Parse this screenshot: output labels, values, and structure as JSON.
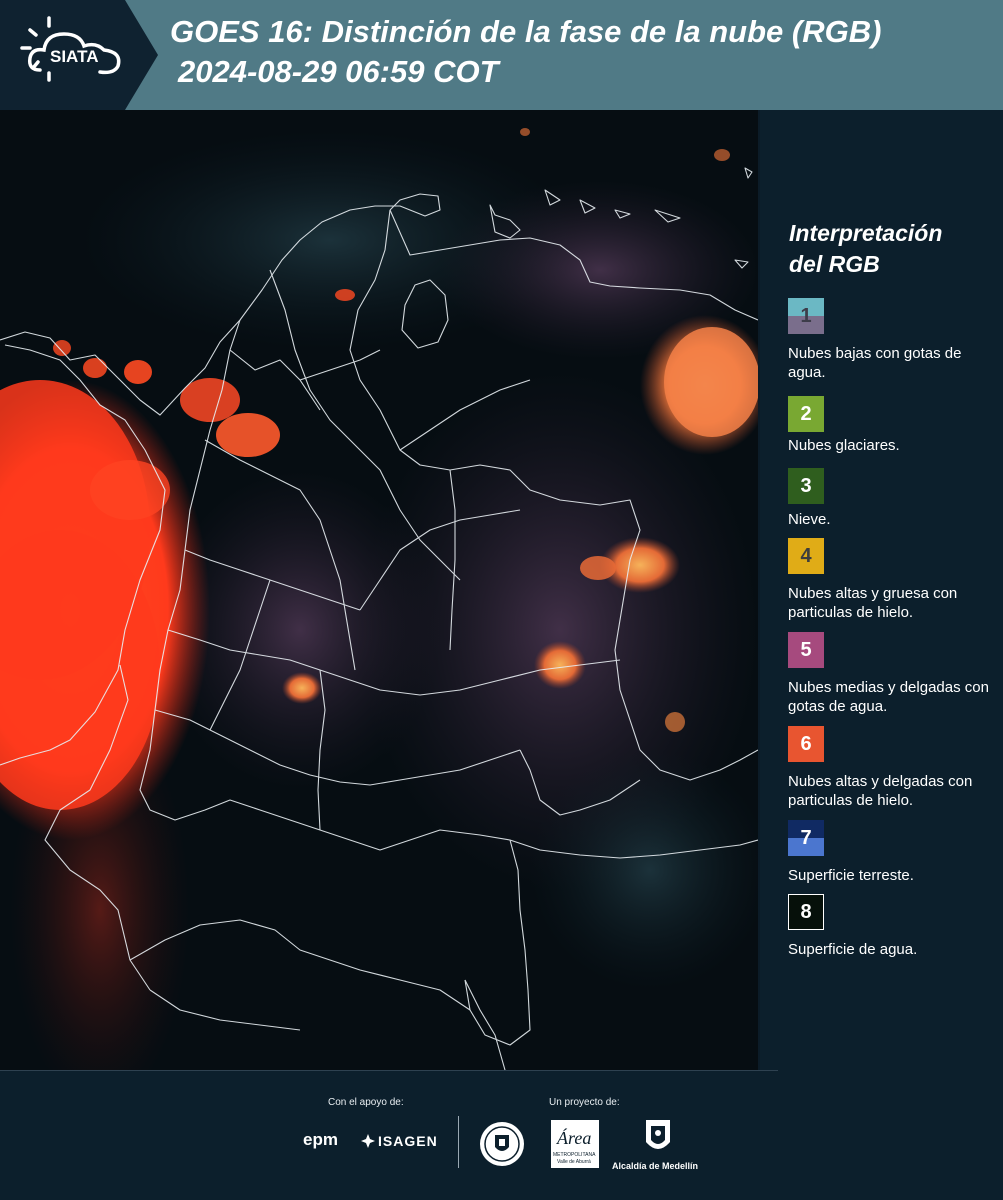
{
  "header": {
    "logo_text": "SIATA",
    "title_line1": "GOES 16: Distinción de la fase de la nube (RGB)",
    "title_line2": "2024-08-29 06:59 COT"
  },
  "legend": {
    "title_line1": "Interpretación",
    "title_line2": "del RGB",
    "items": [
      {
        "number": "1",
        "text": "Nubes bajas con gotas de agua.",
        "color_top": "#6bb8c4",
        "color_bottom": "#7a6e8c",
        "number_color": "#3d3d4a"
      },
      {
        "number": "2",
        "text": "Nubes glaciares.",
        "color_top": "#79a832",
        "color_bottom": "#79a832",
        "number_color": "#ffffff"
      },
      {
        "number": "3",
        "text": "Nieve.",
        "color_top": "#2f5e1e",
        "color_bottom": "#2f5e1e",
        "number_color": "#ffffff"
      },
      {
        "number": "4",
        "text": "Nubes altas y gruesa con particulas de hielo.",
        "color_top": "#e0ac17",
        "color_bottom": "#e0ac17",
        "number_color": "#3d3d3d"
      },
      {
        "number": "5",
        "text": "Nubes medias y delgadas con gotas de agua.",
        "color_top": "#a64a7e",
        "color_bottom": "#a64a7e",
        "number_color": "#ffffff"
      },
      {
        "number": "6",
        "text": "Nubes altas y delgadas con particulas de hielo.",
        "color_top": "#e85530",
        "color_bottom": "#e85530",
        "number_color": "#ffffff"
      },
      {
        "number": "7",
        "text": "Superficie terreste.",
        "color_top": "#102a63",
        "color_bottom": "#4b76cf",
        "number_color": "#ffffff"
      },
      {
        "number": "8",
        "text": "Superficie de agua.",
        "color_top": "#06100a",
        "color_bottom": "#06100a",
        "number_color": "#ffffff"
      }
    ]
  },
  "footer": {
    "support_label": "Con el apoyo de:",
    "project_label": "Un proyecto de:",
    "epm_logo": "epm",
    "isagen_logo": "ISAGEN",
    "area_logo": "Área",
    "area_sub1": "METROPOLITANA",
    "area_sub2": "Valle de Aburrá",
    "alcaldia_logo": "Alcaldía de Medellín"
  },
  "colors": {
    "header_bg": "#507a86",
    "logo_bg": "#0f2230",
    "panel_bg": "#0c1f2c",
    "cloud_red": "#ff3a1c",
    "cloud_orange": "#f3743a"
  }
}
